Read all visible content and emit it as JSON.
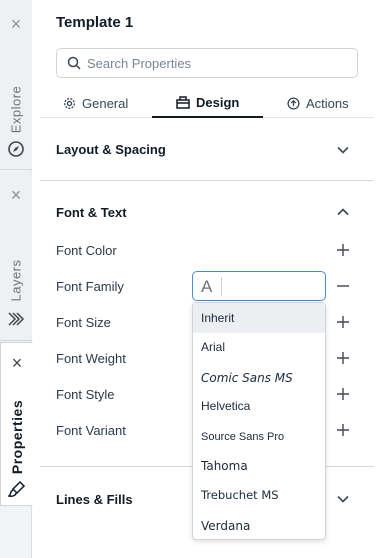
{
  "rail": {
    "tabs": [
      {
        "label": "Explore",
        "active": false,
        "icon": "compass-icon"
      },
      {
        "label": "Layers",
        "active": false,
        "icon": "layers-icon"
      },
      {
        "label": "Properties",
        "active": true,
        "icon": "brush-icon"
      }
    ],
    "close_glyph": "×"
  },
  "panel": {
    "title": "Template 1",
    "search": {
      "placeholder": "Search Properties",
      "value": ""
    },
    "tabs": [
      {
        "label": "General",
        "icon": "gear-icon",
        "active": false
      },
      {
        "label": "Design",
        "icon": "design-icon",
        "active": true
      },
      {
        "label": "Actions",
        "icon": "actions-icon",
        "active": false
      }
    ],
    "sections": {
      "layout": {
        "title": "Layout & Spacing",
        "expanded": false
      },
      "font": {
        "title": "Font & Text",
        "expanded": true
      },
      "lines": {
        "title": "Lines & Fills",
        "expanded": false
      }
    },
    "font_props": [
      {
        "label": "Font Color",
        "action": "+"
      },
      {
        "label": "Font Family",
        "action": "−"
      },
      {
        "label": "Font Size",
        "action": "+"
      },
      {
        "label": "Font Weight",
        "action": "+"
      },
      {
        "label": "Font Style",
        "action": "+"
      },
      {
        "label": "Font Variant",
        "action": "+"
      }
    ],
    "font_family_input": {
      "prefix": "A",
      "value": ""
    },
    "font_family_options": [
      "Inherit",
      "Arial",
      "Comic Sans MS",
      "Helvetica",
      "Source Sans Pro",
      "Tahoma",
      "Trebuchet MS",
      "Verdana"
    ],
    "highlighted_option": "Inherit"
  },
  "colors": {
    "accent_border": "#4a8bd6",
    "text_dark": "#111c28",
    "rail_bg": "#f1f3f5"
  }
}
